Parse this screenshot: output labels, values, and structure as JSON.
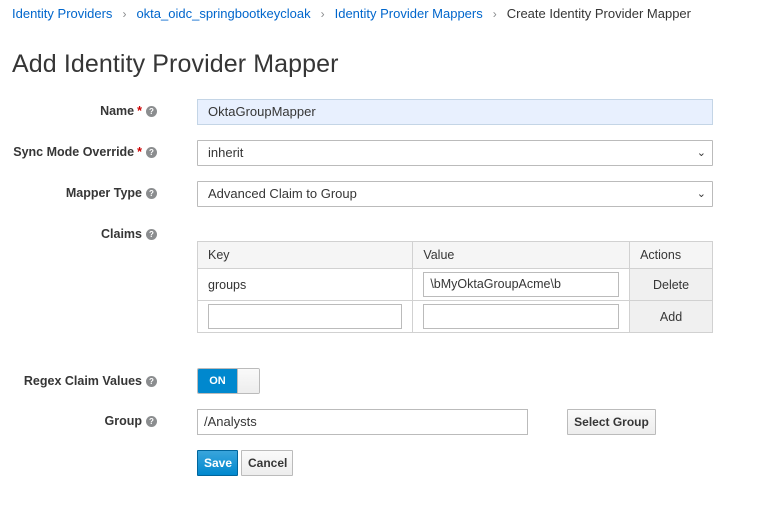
{
  "breadcrumb": {
    "items": [
      "Identity Providers",
      "okta_oidc_springbootkeycloak",
      "Identity Provider Mappers"
    ],
    "current": "Create Identity Provider Mapper"
  },
  "page": {
    "title": "Add Identity Provider Mapper"
  },
  "form": {
    "name": {
      "label": "Name",
      "value": "OktaGroupMapper"
    },
    "sync_mode": {
      "label": "Sync Mode Override",
      "selected": "inherit"
    },
    "mapper_type": {
      "label": "Mapper Type",
      "selected": "Advanced Claim to Group"
    },
    "claims": {
      "label": "Claims",
      "columns": [
        "Key",
        "Value",
        "Actions"
      ],
      "rows": [
        {
          "key": "groups",
          "value": "\\bMyOktaGroupAcme\\b",
          "action": "Delete"
        }
      ],
      "new_row": {
        "key": "",
        "value": "",
        "action": "Add"
      }
    },
    "regex": {
      "label": "Regex Claim Values",
      "state": "ON"
    },
    "group": {
      "label": "Group",
      "value": "/Analysts",
      "select_label": "Select Group"
    },
    "required_mark": "*",
    "help_glyph": "?"
  },
  "buttons": {
    "save": "Save",
    "cancel": "Cancel"
  },
  "colors": {
    "link": "#0066cc",
    "primary": "#0088ce",
    "required": "#cc0000"
  }
}
